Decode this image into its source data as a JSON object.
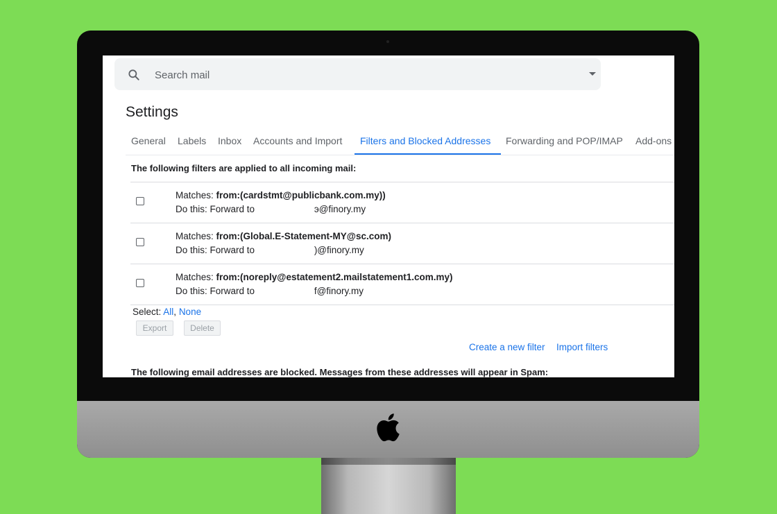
{
  "search": {
    "placeholder": "Search mail"
  },
  "page": {
    "title": "Settings"
  },
  "tabs": [
    {
      "label": "General"
    },
    {
      "label": "Labels"
    },
    {
      "label": "Inbox"
    },
    {
      "label": "Accounts and Import"
    },
    {
      "label": "Filters and Blocked Addresses"
    },
    {
      "label": "Forwarding and POP/IMAP"
    },
    {
      "label": "Add-ons"
    }
  ],
  "active_tab": "Filters and Blocked Addresses",
  "filters_heading": "The following filters are applied to all incoming mail:",
  "filters": [
    {
      "match_prefix": "Matches: ",
      "match_value": "from:(cardstmt@publicbank.com.my))",
      "action_prefix": "Do this: Forward to",
      "action_suffix": "э@finory.my"
    },
    {
      "match_prefix": "Matches: ",
      "match_value": "from:(Global.E-Statement-MY@sc.com)",
      "action_prefix": "Do this: Forward to",
      "action_suffix": ")@finory.my"
    },
    {
      "match_prefix": "Matches: ",
      "match_value": "from:(noreply@estatement2.mailstatement1.com.my)",
      "action_prefix": "Do this: Forward to",
      "action_suffix": "f@finory.my"
    }
  ],
  "select": {
    "prefix": "Select: ",
    "all": "All",
    "separator": ", ",
    "none": "None"
  },
  "buttons": {
    "export": "Export",
    "delete": "Delete"
  },
  "links": {
    "create_filter": "Create a new filter",
    "import_filters": "Import filters"
  },
  "blocked_heading": "The following email addresses are blocked. Messages from these addresses will appear in Spam:",
  "colors": {
    "background": "#7ddc55",
    "accent": "#1a73e8",
    "monitor": "#0b0b0b"
  }
}
